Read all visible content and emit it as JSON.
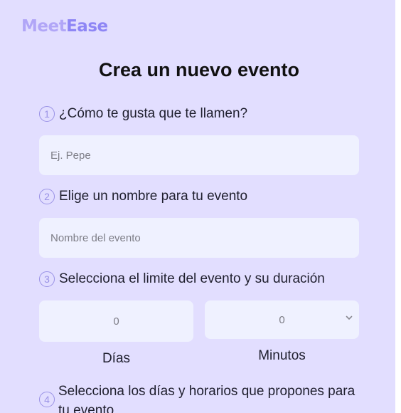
{
  "header": {
    "logo_part1": "Meet",
    "logo_part2": "Ease"
  },
  "main": {
    "title": "Crea un nuevo evento"
  },
  "steps": [
    {
      "number": "1",
      "label": "¿Cómo te gusta que te llamen?"
    },
    {
      "number": "2",
      "label": "Elige un nombre para tu evento"
    },
    {
      "number": "3",
      "label": "Selecciona el limite del evento y su duración"
    },
    {
      "number": "4",
      "label": "Selecciona los días y horarios que propones para tu evento"
    }
  ],
  "fields": {
    "name_placeholder": "Ej. Pepe",
    "event_name_placeholder": "Nombre del evento",
    "days_value": "0",
    "days_caption": "Días",
    "minutes_value": "0",
    "minutes_caption": "Minutos"
  },
  "icons": {
    "select_arrow": "chevron-down-icon"
  },
  "colors": {
    "background": "#e2deff",
    "input_background": "#eff1ff",
    "accent": "#8e86f5",
    "accent_light": "#b1a6f7",
    "step_circle": "#9a92e6"
  }
}
